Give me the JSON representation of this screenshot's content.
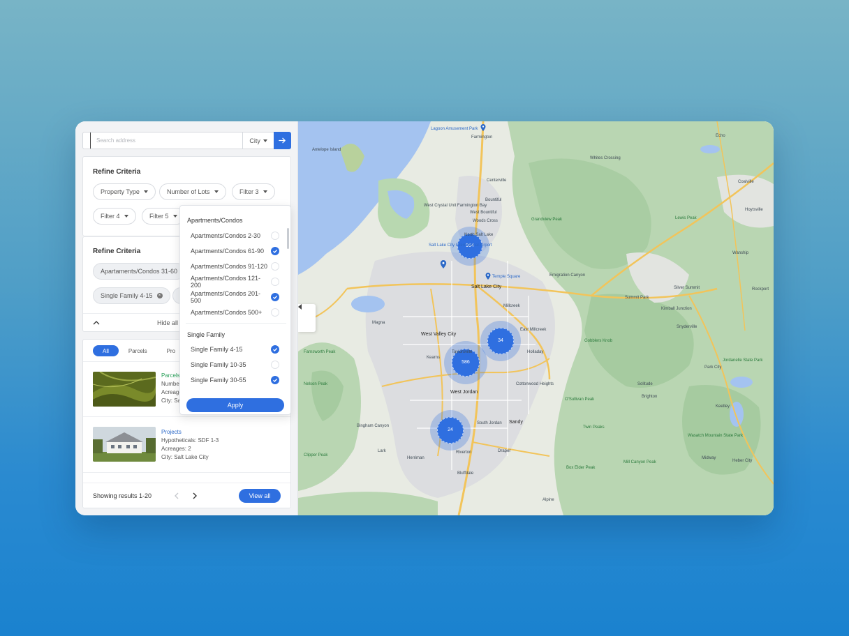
{
  "search": {
    "placeholder": "Search address",
    "city_label": "City"
  },
  "criteria1": {
    "title": "Refine Criteria",
    "filters": [
      "Property Type",
      "Number of Lots",
      "Filter 3",
      "Filter 4",
      "Filter 5"
    ]
  },
  "criteria2": {
    "title": "Refine Criteria",
    "tags": [
      "Apartaments/Condos 31-60",
      "Single Family 4-15"
    ],
    "hide_label": "Hide all s"
  },
  "dropdown": {
    "groups": [
      {
        "label": "Apartments/Condos",
        "items": [
          {
            "label": "Apartments/Condos 2-30",
            "checked": false
          },
          {
            "label": "Apartments/Condos 61-90",
            "checked": true
          },
          {
            "label": "Apartments/Condos 91-120",
            "checked": false
          },
          {
            "label": "Apartments/Condos 121-200",
            "checked": false
          },
          {
            "label": "Apartments/Condos 201-500",
            "checked": true
          },
          {
            "label": "Apartments/Condos 500+",
            "checked": false
          }
        ]
      },
      {
        "label": "Single Family",
        "items": [
          {
            "label": "Single Family 4-15",
            "checked": true
          },
          {
            "label": "Single Family 10-35",
            "checked": false
          },
          {
            "label": "Single Family 30-55",
            "checked": true
          }
        ]
      }
    ],
    "apply_label": "Apply"
  },
  "results": {
    "tabs": [
      "All",
      "Parcels",
      "Pro"
    ],
    "items": [
      {
        "category": "Parcels",
        "lines": [
          "Number",
          "Acreages",
          "City: Salt"
        ]
      },
      {
        "category": "Projects",
        "lines": [
          "Hypotheticals: SDF 1-3",
          "Acreages: 2",
          "City: Salt Lake City"
        ]
      }
    ],
    "showing": "Showing results 1-20",
    "view_all": "View all"
  },
  "map": {
    "clusters": [
      "964",
      "34",
      "586",
      "24"
    ],
    "labels": {
      "lagoon": "Lagoon Amusement Park",
      "farmington": "Farmington",
      "antelope": "Antelope Island",
      "centerville": "Centerville",
      "bountiful": "Bountiful",
      "woods_cross": "Woods Cross",
      "north_sl": "North Salt Lake",
      "west_bountiful": "West Bountiful",
      "whites_crossing": "Whites Crossing",
      "lewis_peak": "Lewis Peak",
      "grandview": "Grandview Peak",
      "wildlife": "West Crystal Unit Farmington Bay",
      "airport": "Salt Lake City International Airport",
      "temple": "Temple Square",
      "slc": "Salt Lake City",
      "emigration": "Emigration Canyon",
      "silver_summit": "Silver Summit",
      "summit_park": "Summit Park",
      "kimball": "Kimball Junction",
      "snyderville": "Snyderville",
      "rockport": "Rockport",
      "magna": "Magna",
      "west_valley": "West Valley City",
      "taylorsville": "Taylorsville",
      "kearns": "Kearns",
      "millcreek": "Millcreek",
      "holladay": "Holladay",
      "east_millcreek": "East Millcreek",
      "gobblers": "Gobblers Knob",
      "park_city": "Park City",
      "farnsworth": "Farnsworth Peak",
      "nelson": "Nelson Peak",
      "west_jordan": "West Jordan",
      "cottonwood": "Cottonwood Heights",
      "sandy": "Sandy",
      "osullivan": "O'Sullivan Peak",
      "twin": "Twin Peaks",
      "jordanelle": "Jordanelle State Park",
      "bingham": "Bingham Canyon",
      "herriman": "Herriman",
      "riverton": "Riverton",
      "draper": "Draper",
      "bluffdale": "Bluffdale",
      "alpine": "Alpine",
      "clipper": "Clipper Peak",
      "lark": "Lark",
      "box_elder": "Box Elder Peak",
      "mill_canyon": "Mill Canyon Peak",
      "wasatch": "Wasatch Mountain State Park",
      "midway": "Midway",
      "heber": "Heber City",
      "keetley": "Keetley",
      "hoytsville": "Hoytsville",
      "coalville": "Coalville",
      "echo": "Echo",
      "wanship": "Wanship",
      "brighton": "Brighton",
      "solitude": "Solitude",
      "south_jordan": "South Jordan"
    }
  }
}
